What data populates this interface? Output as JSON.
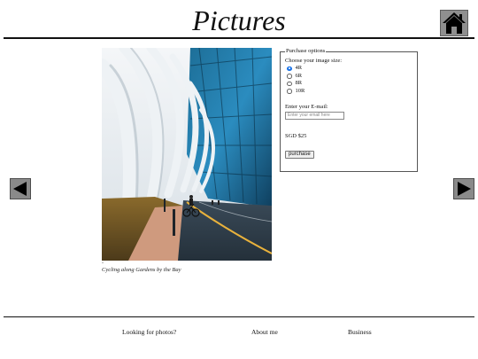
{
  "header": {
    "title": "Pictures",
    "home_icon": "home-icon"
  },
  "photo": {
    "alt": "Cycling along Gardens by the Bay",
    "marker": "-",
    "caption": "Cycling along Gardens by the Bay"
  },
  "navigation": {
    "prev_icon": "arrow-left-icon",
    "next_icon": "arrow-right-icon"
  },
  "purchase": {
    "legend": "Purchase options",
    "size_prompt": "Choose your image size:",
    "sizes": [
      {
        "label": "4R",
        "selected": true
      },
      {
        "label": "6R",
        "selected": false
      },
      {
        "label": "8R",
        "selected": false
      },
      {
        "label": "10R",
        "selected": false
      }
    ],
    "email_label": "Enter your E-mail:",
    "email_placeholder": "Enter your email here",
    "price": "SGD $25",
    "button_label": "purchase"
  },
  "footer": {
    "links": [
      "Looking for photos?",
      "About me",
      "Business"
    ]
  },
  "colors": {
    "radio_checked": "#1a73e8",
    "button_gray": "#8a8a8a"
  }
}
